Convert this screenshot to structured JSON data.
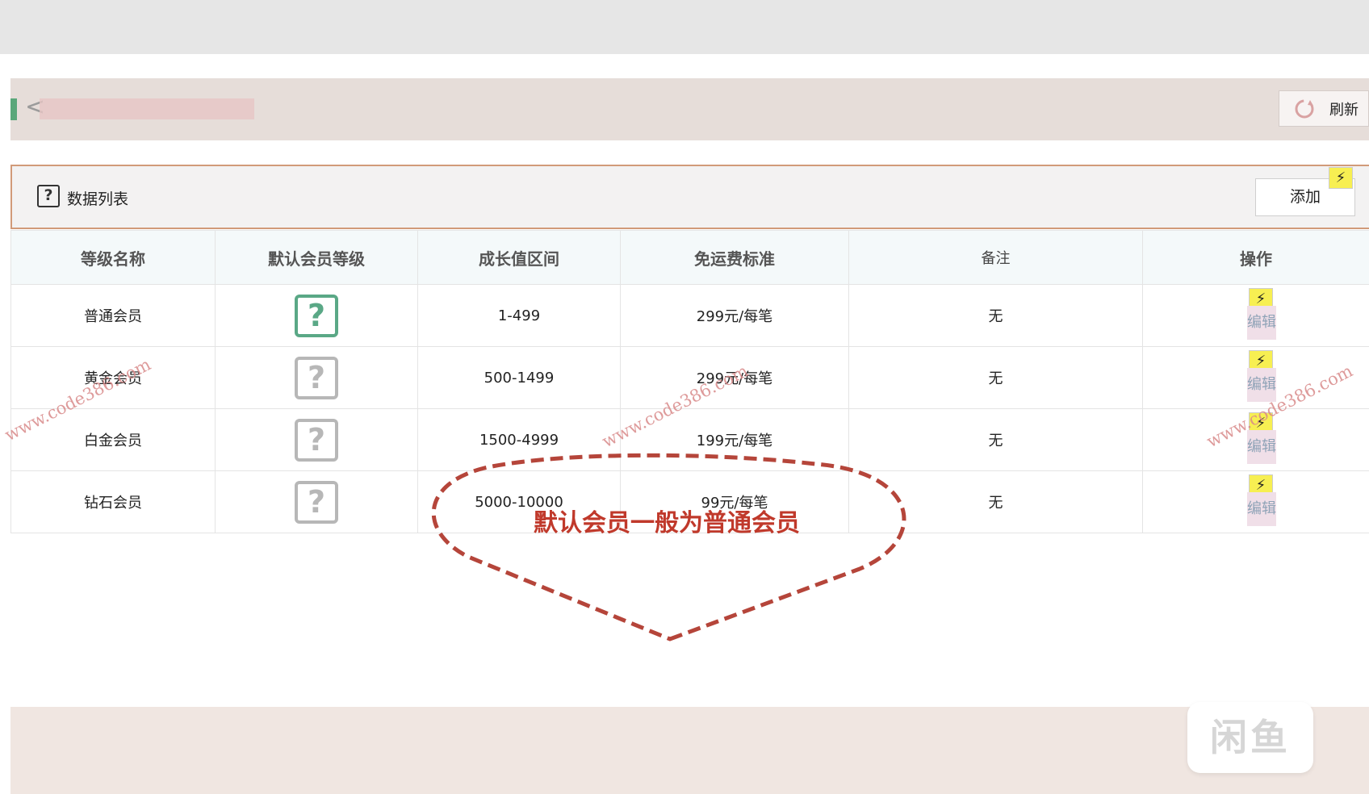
{
  "tabbar": {
    "back_glyph": "<",
    "refresh_label": "刷新",
    "refresh_icon": "refresh-icon"
  },
  "panel": {
    "title": "数据列表",
    "add_label": "添加",
    "title_icon": "question-icon"
  },
  "table": {
    "headers": [
      "等级名称",
      "默认会员等级",
      "成长值区间",
      "免运费标准",
      "备注",
      "操作"
    ],
    "rows": [
      {
        "name": "普通会员",
        "default": true,
        "range": "1-499",
        "shipping": "299元/每笔",
        "note": "无",
        "action": "编辑"
      },
      {
        "name": "黄金会员",
        "default": false,
        "range": "500-1499",
        "shipping": "299元/每笔",
        "note": "无",
        "action": "编辑"
      },
      {
        "name": "白金会员",
        "default": false,
        "range": "1500-4999",
        "shipping": "199元/每笔",
        "note": "无",
        "action": "编辑"
      },
      {
        "name": "钻石会员",
        "default": false,
        "range": "5000-10000",
        "shipping": "99元/每笔",
        "note": "无",
        "action": "编辑"
      }
    ]
  },
  "annotation": {
    "text": "默认会员一般为普通会员",
    "color": "#c0392b"
  },
  "watermark": "www.code386.com",
  "footer_logo": "闲鱼",
  "colors": {
    "accent_green": "#5aa886",
    "bolt_yellow": "#f7ef52",
    "panel_border": "#d19a79"
  }
}
